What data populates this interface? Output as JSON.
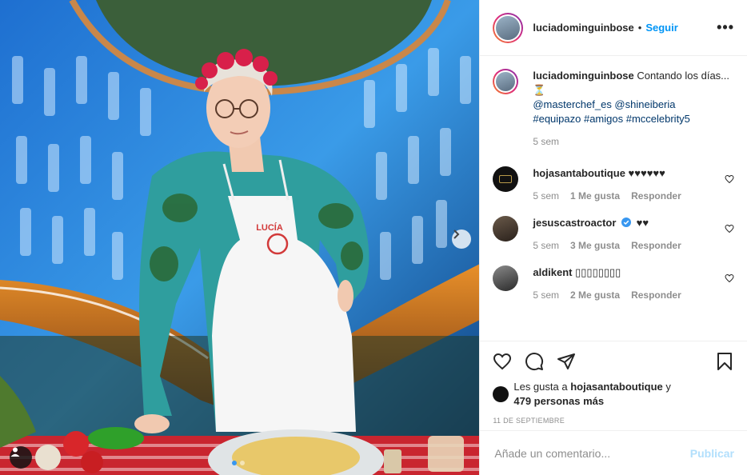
{
  "post": {
    "author": "luciadominguinbose",
    "follow_label": "Seguir",
    "separator": "•",
    "more_label": "•••",
    "caption": {
      "username": "luciadominguinbose",
      "text": "Contando los días... ⏳",
      "line2": "@masterchef_es @shineiberia",
      "line3": "#equipazo #amigos #mccelebrity5",
      "time": "5 sem"
    },
    "comments": [
      {
        "username": "hojasantaboutique",
        "text": "♥♥♥♥♥♥",
        "time": "5 sem",
        "likes": "1 Me gusta",
        "reply": "Responder"
      },
      {
        "username": "jesuscastroactor",
        "text": "♥♥",
        "time": "5 sem",
        "likes": "3 Me gusta",
        "reply": "Responder",
        "verified": true
      },
      {
        "username": "aldikent",
        "text": "▯▯▯▯▯▯▯▯",
        "time": "5 sem",
        "likes": "2 Me gusta",
        "reply": "Responder"
      }
    ],
    "likes_prefix": "Les gusta a",
    "likes_user": "hojasantaboutique",
    "likes_and": "y",
    "likes_others": "479 personas más",
    "date": "11 DE SEPTIEMBRE",
    "comment_placeholder": "Añade un comentario...",
    "publish_label": "Publicar",
    "apron_text": "LUCÍA"
  },
  "icons": [
    "heart-icon",
    "comment-icon",
    "share-icon",
    "bookmark-icon",
    "chevron-right-icon",
    "user-tag-icon",
    "verified-icon"
  ],
  "colors": {
    "accent": "#0095f6",
    "muted": "#8e8e8e",
    "publish_disabled": "#b2dffc",
    "link": "#00376b"
  }
}
